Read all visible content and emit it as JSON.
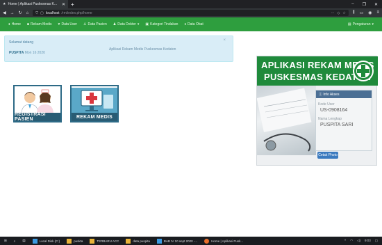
{
  "browser": {
    "tab_title": "Home | Aplikasi Puskesmas K...",
    "new_tab": "+",
    "url_host": "localhost",
    "url_path": "/rm/index.php/home",
    "window_controls": [
      "–",
      "❐",
      "✕"
    ]
  },
  "appnav": {
    "items": [
      "Home",
      "Rekam Medis",
      "Data User",
      "Data Pasien",
      "Data Dokter",
      "Kategori Tindakan",
      "Data Obat"
    ],
    "settings": "Pengaturan"
  },
  "alert": {
    "greeting": "Selamat datang",
    "username": "PUSPITA",
    "date": "Mon 16 2020",
    "message": "Aplikasi Rekam Medis Puskesmas Kedaton",
    "close": "×"
  },
  "tiles": {
    "registrasi": "REGISTRASI PASIEN",
    "rekam": "REKAM MEDIS"
  },
  "sidebar": {
    "title_line1": "APLIKASI REKAM MEDIS",
    "title_line2": "PUSKESMAS KEDATON",
    "info_title": "Info Akses",
    "kode_label": "Kode User",
    "kode_value": "US-0908164",
    "nama_label": "Nama Lengkap",
    "nama_value": "PUSPITA SARI",
    "photo_button": "Cetak Photo"
  },
  "taskbar": {
    "items": [
      "Local Disk (C:)",
      "puskta",
      "TERBARU ACC",
      "data puspita",
      "BAB IV 10 sept 2020 -...",
      "Home | Aplikasi Pusk..."
    ],
    "time": "9:03"
  }
}
